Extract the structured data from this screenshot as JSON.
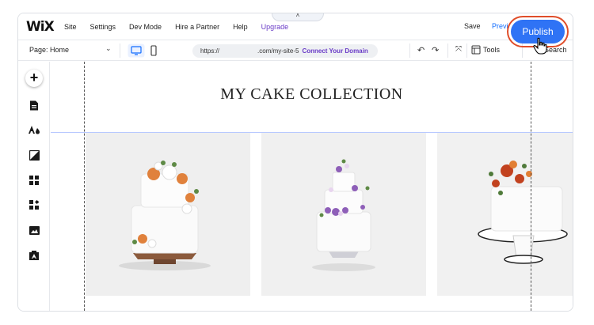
{
  "topbar": {
    "logo": "WiX",
    "menu": [
      "Site",
      "Settings",
      "Dev Mode",
      "Hire a Partner",
      "Help",
      "Upgrade"
    ],
    "collapse_glyph": "˄",
    "save_label": "Save",
    "preview_label": "Previ",
    "publish_label": "Publish"
  },
  "toolbar": {
    "page_label": "Page: Home",
    "page_chevron": "⌄",
    "url_prefix": "https://",
    "url_site": ".com/my-site-5",
    "connect_domain": "Connect Your Domain",
    "undo_glyph": "↶",
    "redo_glyph": "↷",
    "zoom_glyph": "⤧",
    "tools_label": "Tools",
    "search_label": "Search"
  },
  "sidebar": {
    "add_glyph": "+",
    "items": [
      "pages-icon",
      "design-icon",
      "background-icon",
      "apps-icon",
      "add-apps-icon",
      "media-icon",
      "portfolio-icon"
    ]
  },
  "canvas": {
    "site_title": "MY CAKE COLLECTION",
    "photos": [
      {
        "alt": "White frosted cake with orange and white flowers on bronze stand"
      },
      {
        "alt": "Three-tier white cake with purple flowers on pedestal"
      },
      {
        "alt": "White cake with red and orange flowers on cake stand"
      }
    ]
  },
  "colors": {
    "accent": "#116dff",
    "publish": "#2f73f5",
    "upgrade": "#6a3cc7",
    "highlight_ring": "#e04e2b"
  }
}
